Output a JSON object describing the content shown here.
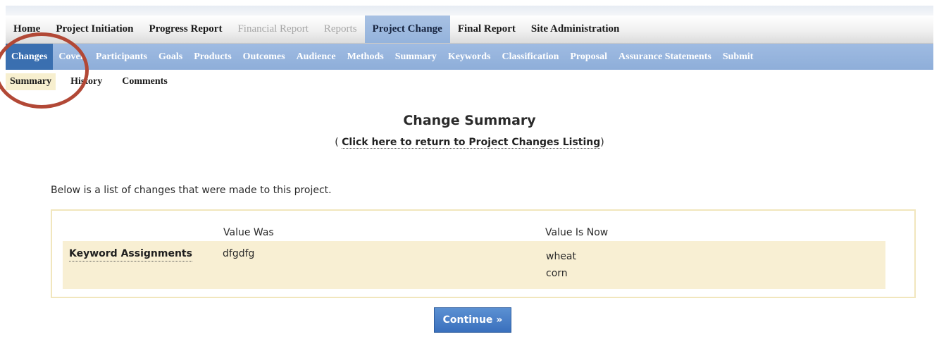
{
  "main_nav": [
    {
      "label": "Home",
      "state": "normal"
    },
    {
      "label": "Project Initiation",
      "state": "normal"
    },
    {
      "label": "Progress Report",
      "state": "normal"
    },
    {
      "label": "Financial Report",
      "state": "disabled"
    },
    {
      "label": "Reports",
      "state": "disabled"
    },
    {
      "label": "Project Change",
      "state": "active"
    },
    {
      "label": "Final Report",
      "state": "normal"
    },
    {
      "label": "Site Administration",
      "state": "normal"
    }
  ],
  "sub_nav": [
    {
      "label": "Changes",
      "state": "active"
    },
    {
      "label": "Cover",
      "state": "normal"
    },
    {
      "label": "Participants",
      "state": "normal"
    },
    {
      "label": "Goals",
      "state": "normal"
    },
    {
      "label": "Products",
      "state": "normal"
    },
    {
      "label": "Outcomes",
      "state": "normal"
    },
    {
      "label": "Audience",
      "state": "normal"
    },
    {
      "label": "Methods",
      "state": "normal"
    },
    {
      "label": "Summary",
      "state": "normal"
    },
    {
      "label": "Keywords",
      "state": "normal"
    },
    {
      "label": "Classification",
      "state": "normal"
    },
    {
      "label": "Proposal",
      "state": "normal"
    },
    {
      "label": "Assurance Statements",
      "state": "normal"
    },
    {
      "label": "Submit",
      "state": "normal"
    }
  ],
  "tab_nav": [
    {
      "label": "Summary",
      "state": "active"
    },
    {
      "label": "History",
      "state": "normal"
    },
    {
      "label": "Comments",
      "state": "normal"
    }
  ],
  "page": {
    "title": "Change Summary",
    "return_prefix": "( ",
    "return_link": "Click here to return to Project Changes Listing",
    "return_suffix": ")",
    "intro": "Below is a list of changes that were made to this project."
  },
  "changes_table": {
    "headers": {
      "was": "Value Was",
      "now": "Value Is Now"
    },
    "rows": [
      {
        "field": "Keyword Assignments",
        "was": "dfgdfg",
        "now": [
          "wheat",
          "corn"
        ]
      }
    ]
  },
  "continue_label": "Continue »",
  "colors": {
    "accent_blue": "#3a70bd",
    "highlight_ring": "#b24836",
    "row_tint": "#f8efd3"
  }
}
